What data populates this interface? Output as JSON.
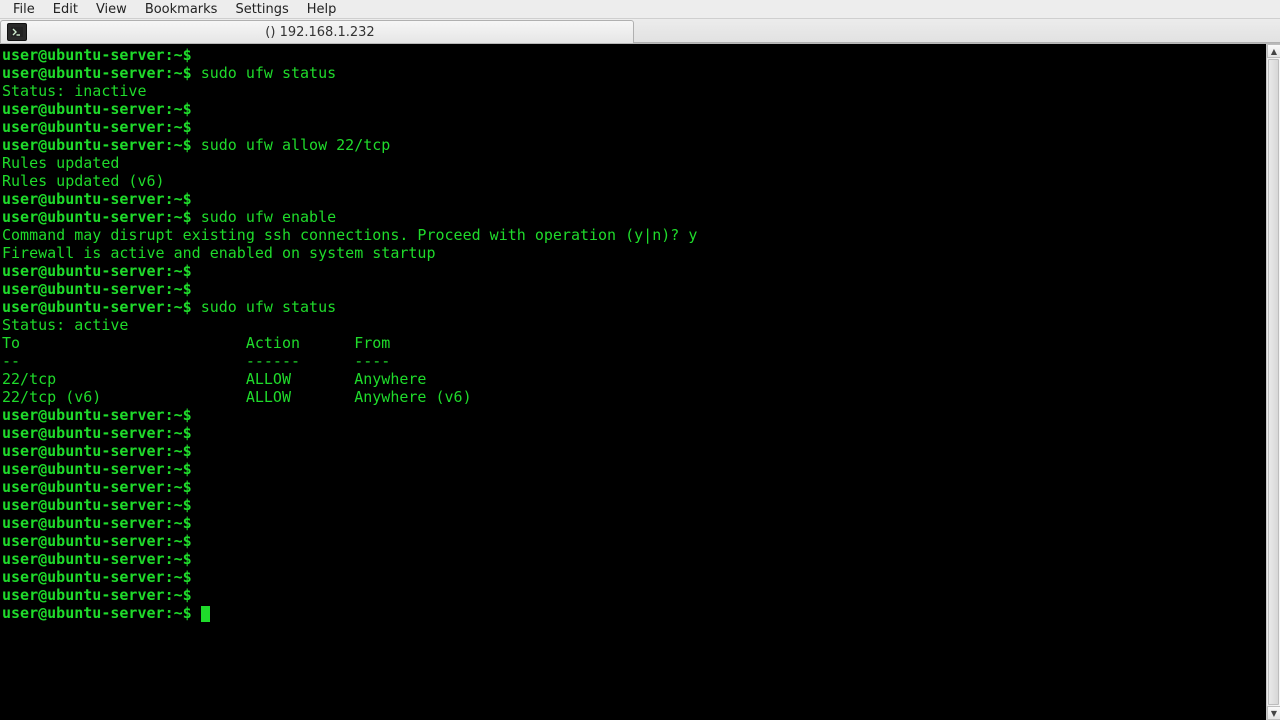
{
  "menu": {
    "file": "File",
    "edit": "Edit",
    "view": "View",
    "bookmarks": "Bookmarks",
    "settings": "Settings",
    "help": "Help"
  },
  "tab": {
    "title": "() 192.168.1.232"
  },
  "terminal": {
    "lines": [
      {
        "type": "prompt",
        "user": "user@ubuntu-server",
        "path": "~",
        "cmd": ""
      },
      {
        "type": "prompt",
        "user": "user@ubuntu-server",
        "path": "~",
        "cmd": "sudo ufw status"
      },
      {
        "type": "output",
        "text": "Status: inactive"
      },
      {
        "type": "prompt",
        "user": "user@ubuntu-server",
        "path": "~",
        "cmd": ""
      },
      {
        "type": "prompt",
        "user": "user@ubuntu-server",
        "path": "~",
        "cmd": ""
      },
      {
        "type": "prompt",
        "user": "user@ubuntu-server",
        "path": "~",
        "cmd": "sudo ufw allow 22/tcp"
      },
      {
        "type": "output",
        "text": "Rules updated"
      },
      {
        "type": "output",
        "text": "Rules updated (v6)"
      },
      {
        "type": "prompt",
        "user": "user@ubuntu-server",
        "path": "~",
        "cmd": ""
      },
      {
        "type": "prompt",
        "user": "user@ubuntu-server",
        "path": "~",
        "cmd": "sudo ufw enable"
      },
      {
        "type": "output",
        "text": "Command may disrupt existing ssh connections. Proceed with operation (y|n)? y"
      },
      {
        "type": "output",
        "text": "Firewall is active and enabled on system startup"
      },
      {
        "type": "prompt",
        "user": "user@ubuntu-server",
        "path": "~",
        "cmd": ""
      },
      {
        "type": "prompt",
        "user": "user@ubuntu-server",
        "path": "~",
        "cmd": ""
      },
      {
        "type": "prompt",
        "user": "user@ubuntu-server",
        "path": "~",
        "cmd": "sudo ufw status"
      },
      {
        "type": "output",
        "text": "Status: active"
      },
      {
        "type": "output",
        "text": ""
      },
      {
        "type": "output",
        "text": "To                         Action      From"
      },
      {
        "type": "output",
        "text": "--                         ------      ----"
      },
      {
        "type": "output",
        "text": "22/tcp                     ALLOW       Anywhere"
      },
      {
        "type": "output",
        "text": "22/tcp (v6)                ALLOW       Anywhere (v6)"
      },
      {
        "type": "output",
        "text": ""
      },
      {
        "type": "prompt",
        "user": "user@ubuntu-server",
        "path": "~",
        "cmd": ""
      },
      {
        "type": "prompt",
        "user": "user@ubuntu-server",
        "path": "~",
        "cmd": ""
      },
      {
        "type": "prompt",
        "user": "user@ubuntu-server",
        "path": "~",
        "cmd": ""
      },
      {
        "type": "prompt",
        "user": "user@ubuntu-server",
        "path": "~",
        "cmd": ""
      },
      {
        "type": "prompt",
        "user": "user@ubuntu-server",
        "path": "~",
        "cmd": ""
      },
      {
        "type": "prompt",
        "user": "user@ubuntu-server",
        "path": "~",
        "cmd": ""
      },
      {
        "type": "prompt",
        "user": "user@ubuntu-server",
        "path": "~",
        "cmd": ""
      },
      {
        "type": "prompt",
        "user": "user@ubuntu-server",
        "path": "~",
        "cmd": ""
      },
      {
        "type": "prompt",
        "user": "user@ubuntu-server",
        "path": "~",
        "cmd": ""
      },
      {
        "type": "prompt",
        "user": "user@ubuntu-server",
        "path": "~",
        "cmd": ""
      },
      {
        "type": "prompt",
        "user": "user@ubuntu-server",
        "path": "~",
        "cmd": ""
      },
      {
        "type": "prompt-cursor",
        "user": "user@ubuntu-server",
        "path": "~",
        "cmd": ""
      }
    ]
  }
}
